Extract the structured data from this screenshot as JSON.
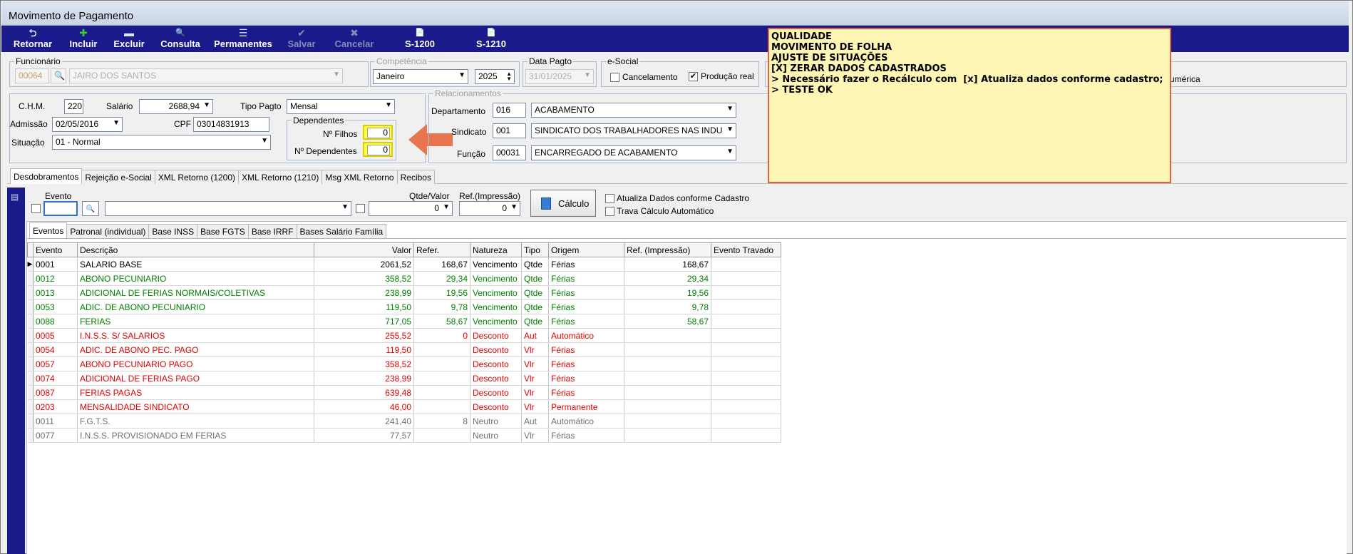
{
  "window": {
    "title": "Movimento de Pagamento"
  },
  "toolbar": {
    "buttons": [
      {
        "label": "Retornar",
        "icon": "return-arrow-icon",
        "glyph": "⮌"
      },
      {
        "label": "Incluir",
        "icon": "plus-circle-icon",
        "glyph": "✚"
      },
      {
        "label": "Excluir",
        "icon": "delete-icon",
        "glyph": "▬"
      },
      {
        "label": "Consulta",
        "icon": "search-icon",
        "glyph": "🔍"
      },
      {
        "label": "Permanentes",
        "icon": "list-icon",
        "glyph": "☰"
      },
      {
        "label": "Salvar",
        "icon": "check-icon",
        "glyph": "✔"
      },
      {
        "label": "Cancelar",
        "icon": "close-icon",
        "glyph": "✖"
      },
      {
        "label": "S-1200",
        "icon": "document-icon",
        "glyph": "📄"
      },
      {
        "label": "S-1210",
        "icon": "document-icon",
        "glyph": "📄"
      }
    ]
  },
  "funcionario": {
    "legend": "Funcionário",
    "codigo": "00064",
    "nome": "JAIRO DOS SANTOS"
  },
  "competencia": {
    "legend": "Competência",
    "mes": "Janeiro",
    "ano": "2025"
  },
  "data_pagto": {
    "legend": "Data Pagto",
    "value": "31/01/2025"
  },
  "esocial": {
    "legend": "e-Social",
    "cancelamento_label": "Cancelamento",
    "cancelamento_checked": false,
    "producao_label": "Produção real",
    "producao_checked": true,
    "extra_label": "umérica"
  },
  "dados": {
    "chm_label": "C.H.M.",
    "chm_value": "220",
    "salario_label": "Salário",
    "salario_value": "2688,94",
    "tipo_pagto_label": "Tipo Pagto",
    "tipo_pagto_value": "Mensal",
    "admissao_label": "Admissão",
    "admissao_value": "02/05/2016",
    "cpf_label": "CPF",
    "cpf_value": "03014831913",
    "situacao_label": "Situação",
    "situacao_value": "01 - Normal"
  },
  "dependentes": {
    "legend": "Dependentes",
    "filhos_label": "Nº Filhos",
    "filhos_value": "0",
    "dependentes_label": "Nº Dependentes",
    "dependentes_value": "0"
  },
  "relacionamentos": {
    "legend": "Relacionamentos",
    "departamento_label": "Departamento",
    "departamento_code": "016",
    "departamento_name": "ACABAMENTO",
    "sindicato_label": "Sindicato",
    "sindicato_code": "001",
    "sindicato_name": "SINDICATO DOS TRABALHADORES NAS INDU",
    "funcao_label": "Função",
    "funcao_code": "00031",
    "funcao_name": "ENCARREGADO DE ACABAMENTO"
  },
  "note": {
    "lines": [
      "QUALIDADE",
      "MOVIMENTO DE FOLHA",
      "AJUSTE DE SITUAÇÕES",
      "[X] ZERAR DADOS CADASTRADOS",
      "",
      "",
      "> Necessário fazer o Recálculo com  [x] Atualiza dados conforme cadastro;",
      "",
      "> TESTE OK"
    ]
  },
  "main_tabs": [
    "Desdobramentos",
    "Rejeição e-Social",
    "XML Retorno (1200)",
    "XML Retorno (1210)",
    "Msg XML Retorno",
    "Recibos"
  ],
  "evento_form": {
    "evento_label": "Evento",
    "evento_value": "",
    "qtde_label": "Qtde/Valor",
    "qtde_value": "0",
    "ref_label": "Ref.(Impressão)",
    "ref_value": "0",
    "calculo_label": "Cálculo",
    "atualiza_label": "Atualiza Dados conforme Cadastro",
    "trava_label": "Trava Cálculo Automático"
  },
  "sub_tabs": [
    "Eventos",
    "Patronal (individual)",
    "Base INSS",
    "Base FGTS",
    "Base IRRF",
    "Bases Salário Família"
  ],
  "grid": {
    "columns": [
      "Evento",
      "Descrição",
      "Valor",
      "Refer.",
      "Natureza",
      "Tipo",
      "Origem",
      "Ref. (Impressão)",
      "Evento Travado"
    ],
    "rows": [
      {
        "color": "black",
        "cells": [
          "0001",
          "SALARIO BASE",
          "2061,52",
          "168,67",
          "Vencimento",
          "Qtde",
          "Férias",
          "168,67",
          ""
        ]
      },
      {
        "color": "green",
        "cells": [
          "0012",
          "ABONO PECUNIARIO",
          "358,52",
          "29,34",
          "Vencimento",
          "Qtde",
          "Férias",
          "29,34",
          ""
        ]
      },
      {
        "color": "green",
        "cells": [
          "0013",
          "ADICIONAL DE FERIAS NORMAIS/COLETIVAS",
          "238,99",
          "19,56",
          "Vencimento",
          "Qtde",
          "Férias",
          "19,56",
          ""
        ]
      },
      {
        "color": "green",
        "cells": [
          "0053",
          "ADIC. DE ABONO PECUNIARIO",
          "119,50",
          "9,78",
          "Vencimento",
          "Qtde",
          "Férias",
          "9,78",
          ""
        ]
      },
      {
        "color": "green",
        "cells": [
          "0088",
          "FERIAS",
          "717,05",
          "58,67",
          "Vencimento",
          "Qtde",
          "Férias",
          "58,67",
          ""
        ]
      },
      {
        "color": "red",
        "cells": [
          "0005",
          "I.N.S.S. S/ SALARIOS",
          "255,52",
          "0",
          "Desconto",
          "Aut",
          "Automático",
          "",
          ""
        ]
      },
      {
        "color": "red",
        "cells": [
          "0054",
          "ADIC. DE ABONO PEC. PAGO",
          "119,50",
          "",
          "Desconto",
          "Vlr",
          "Férias",
          "",
          ""
        ]
      },
      {
        "color": "red",
        "cells": [
          "0057",
          "ABONO PECUNIARIO PAGO",
          "358,52",
          "",
          "Desconto",
          "Vlr",
          "Férias",
          "",
          ""
        ]
      },
      {
        "color": "red",
        "cells": [
          "0074",
          "ADICIONAL DE FERIAS PAGO",
          "238,99",
          "",
          "Desconto",
          "Vlr",
          "Férias",
          "",
          ""
        ]
      },
      {
        "color": "red",
        "cells": [
          "0087",
          "FERIAS PAGAS",
          "639,48",
          "",
          "Desconto",
          "Vlr",
          "Férias",
          "",
          ""
        ]
      },
      {
        "color": "red",
        "cells": [
          "0203",
          "MENSALIDADE SINDICATO",
          "46,00",
          "",
          "Desconto",
          "Vlr",
          "Permanente",
          "",
          ""
        ]
      },
      {
        "color": "gray",
        "cells": [
          "0011",
          "F.G.T.S.",
          "241,40",
          "8",
          "Neutro",
          "Aut",
          "Automático",
          "",
          ""
        ]
      },
      {
        "color": "gray",
        "cells": [
          "0077",
          "I.N.S.S. PROVISIONADO EM FERIAS",
          "77,57",
          "",
          "Neutro",
          "Vlr",
          "Férias",
          "",
          ""
        ]
      }
    ]
  }
}
